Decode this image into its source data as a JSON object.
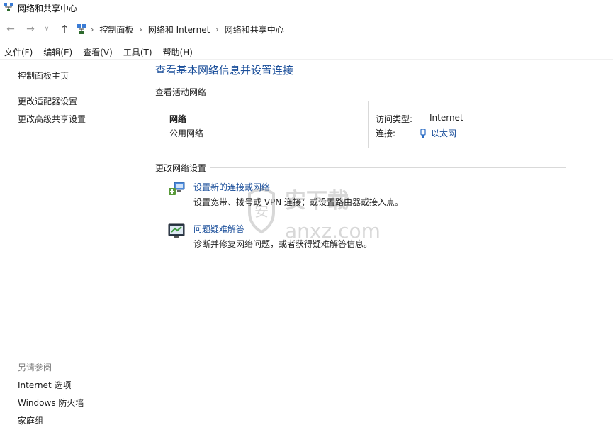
{
  "window": {
    "title": "网络和共享中心"
  },
  "address_bar": {
    "crumbs": [
      "控制面板",
      "网络和 Internet",
      "网络和共享中心"
    ]
  },
  "menu": [
    "文件(F)",
    "编辑(E)",
    "查看(V)",
    "工具(T)",
    "帮助(H)"
  ],
  "sidebar": {
    "home": "控制面板主页",
    "links": [
      "更改适配器设置",
      "更改高级共享设置"
    ],
    "see_also_heading": "另请参阅",
    "see_also": [
      "Internet 选项",
      "Windows 防火墙",
      "家庭组"
    ]
  },
  "main": {
    "title": "查看基本网络信息并设置连接",
    "active_section": "查看活动网络",
    "network": {
      "name": "网络",
      "type": "公用网络",
      "access_label": "访问类型:",
      "access_value": "Internet",
      "conn_label": "连接:",
      "conn_value": "以太网"
    },
    "change_section": "更改网络设置",
    "tasks": [
      {
        "label": "设置新的连接或网络",
        "desc": "设置宽带、拨号或 VPN 连接；或设置路由器或接入点。",
        "icon": "new-connection-icon"
      },
      {
        "label": "问题疑难解答",
        "desc": "诊断并修复网络问题，或者获得疑难解答信息。",
        "icon": "troubleshoot-icon"
      }
    ]
  },
  "watermark": {
    "text": "anxz.com",
    "brand": "安下载"
  },
  "colors": {
    "link": "#1a4e9a",
    "muted": "#7a7a7a",
    "rule": "#d9d9d9"
  }
}
